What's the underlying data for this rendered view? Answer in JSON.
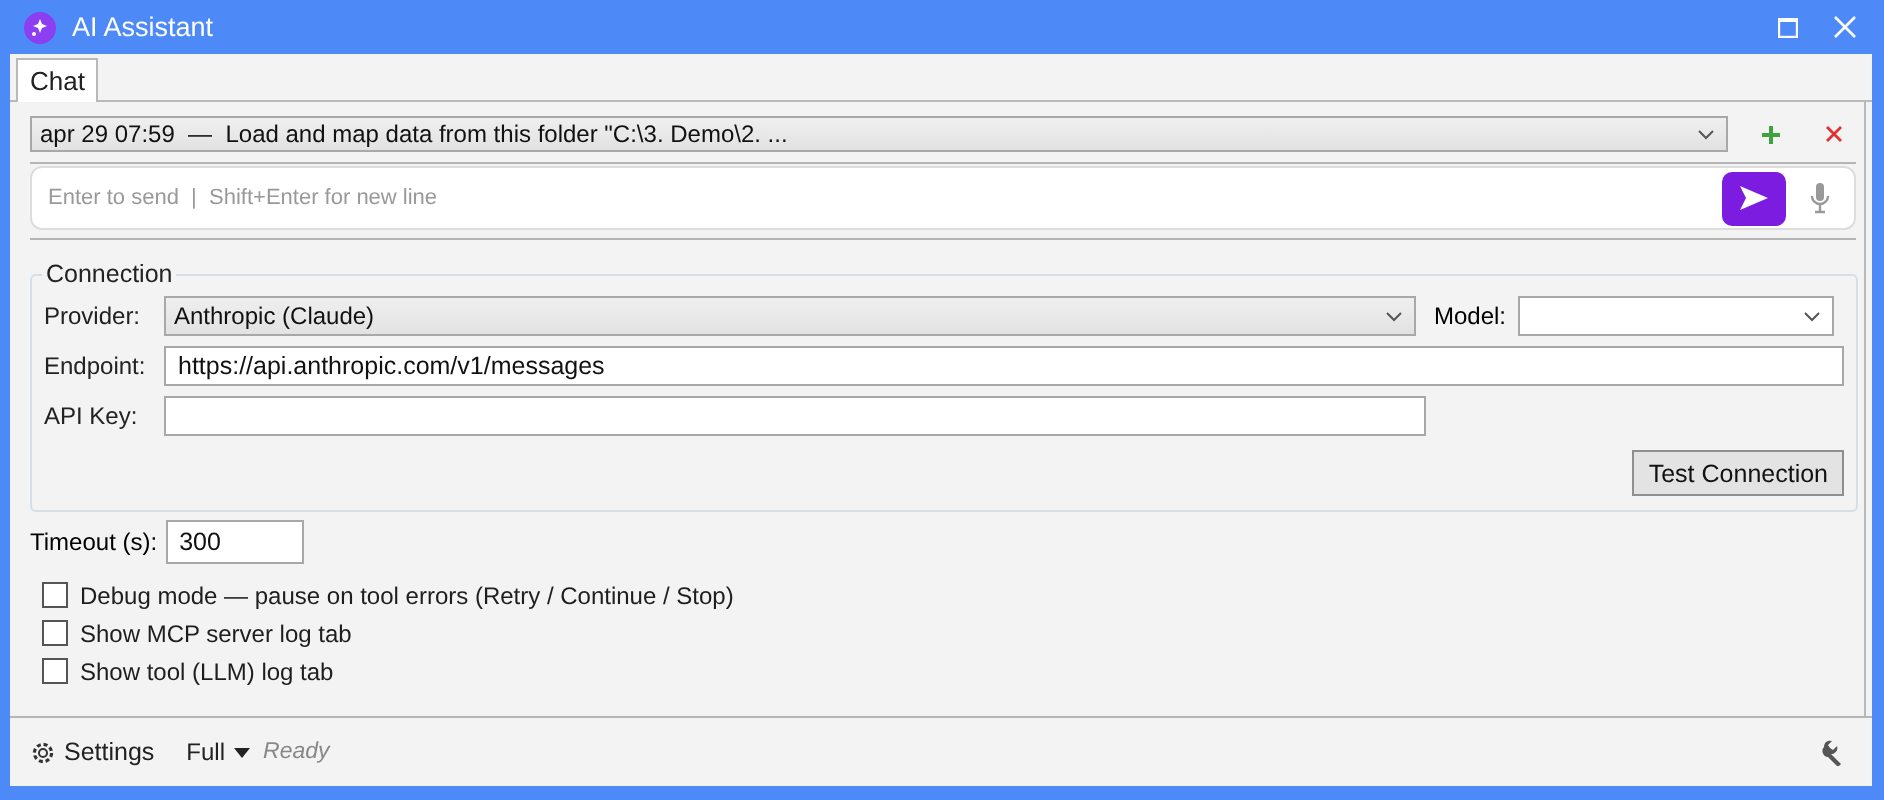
{
  "window": {
    "title": "AI Assistant"
  },
  "tabs": [
    {
      "label": "Chat",
      "selected": true
    }
  ],
  "session": {
    "value": "apr 29 07:59  —  Load and map data from this folder \"C:\\3. Demo\\2. ..."
  },
  "input": {
    "placeholder": "Enter to send  |  Shift+Enter for new line"
  },
  "connection": {
    "title": "Connection",
    "provider_label": "Provider:",
    "provider": "Anthropic (Claude)",
    "model_label": "Model:",
    "endpoint_label": "Endpoint:",
    "endpoint": "https://api.anthropic.com/v1/messages",
    "api_key_label": "API Key:",
    "test_button": "Test Connection"
  },
  "timeout": {
    "label": "Timeout (s):",
    "value": "300"
  },
  "options": [
    {
      "label": "Debug mode — pause on tool errors (Retry / Continue / Stop)",
      "checked": false
    },
    {
      "label": "Show MCP server log tab",
      "checked": false
    },
    {
      "label": "Show tool (LLM) log tab",
      "checked": false
    }
  ],
  "status_bar": {
    "settings": "Settings",
    "mode": "Full",
    "status": "Ready"
  }
}
